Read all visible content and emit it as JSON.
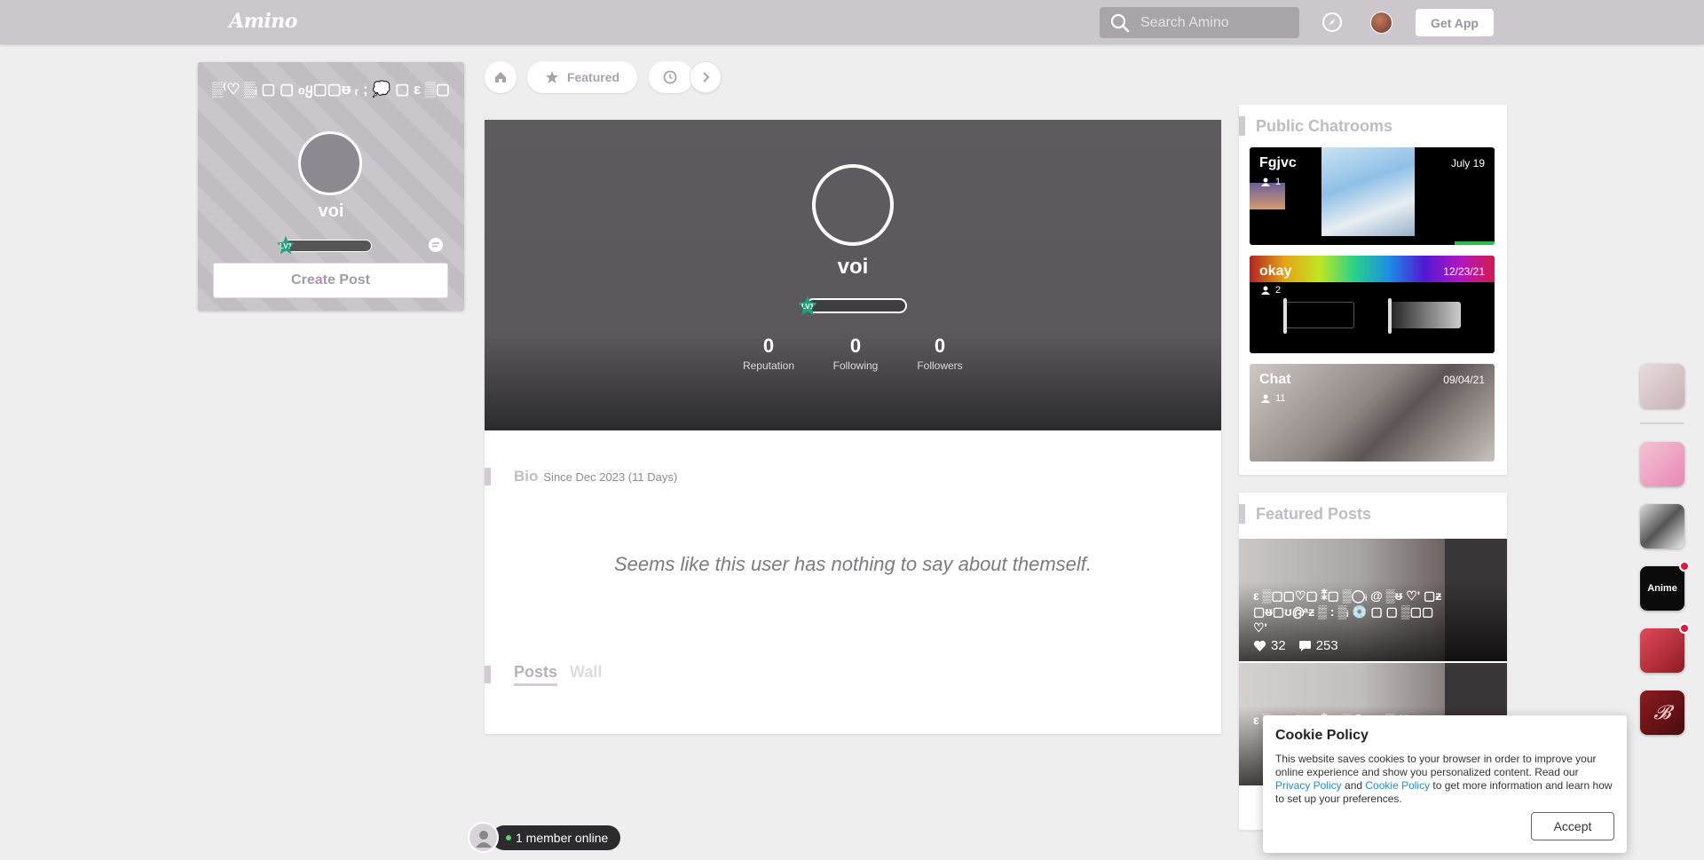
{
  "header": {
    "logo": "Amino",
    "search_placeholder": "Search Amino",
    "get_app": "Get App"
  },
  "left_card": {
    "community_name": "▒⁽♡ ▒ᵢ ▢ ▢ ℴყ▢▢ᵿ ᵣ ; 💭 ▢ ε ▒▢",
    "username": "voi",
    "level": "LV1",
    "create_post": "Create Post"
  },
  "tabs": {
    "featured": "Featured"
  },
  "profile": {
    "username": "voi",
    "level": "LV1",
    "stats": [
      {
        "value": "0",
        "label": "Reputation"
      },
      {
        "value": "0",
        "label": "Following"
      },
      {
        "value": "0",
        "label": "Followers"
      }
    ],
    "bio_title": "Bio",
    "bio_since": "Since Dec 2023 (11 Days)",
    "bio_text": "Seems like this user has nothing to say about themself.",
    "tab_posts": "Posts",
    "tab_wall": "Wall"
  },
  "public_chatrooms": {
    "title": "Public Chatrooms",
    "rooms": [
      {
        "name": "Fgjvc",
        "date": "July 19",
        "members": "1"
      },
      {
        "name": "okay",
        "date": "12/23/21",
        "members": "2"
      },
      {
        "name": "Chat",
        "date": "09/04/21",
        "members": "11"
      }
    ]
  },
  "featured_posts": {
    "title": "Featured Posts",
    "posts": [
      {
        "title": "ε ▒▢▢♡▢ ⁑▢ ▒◯ᵢ @ ▒ᵿ ♡' ▢ᵶ▢ᵿ▢ʊ൫ᵃᵶ ▒ : ▒ᵢ 💿 ▢ ▢ ▒▢▢ ♡'",
        "likes": "32",
        "comments": "253"
      },
      {
        "title": "ε ▒▢▢♡▢ ⁑▢ ▒◯ᵢ ▢ ▒ ♡' ▢ ▢",
        "likes": "",
        "comments": ""
      }
    ]
  },
  "side_communities": {
    "anime_label": "Anime"
  },
  "online": {
    "text": "1 member online"
  },
  "cookie": {
    "title": "Cookie Policy",
    "text1": "This website saves cookies to your browser in order to improve your online experience and show you personalized content. Read our ",
    "privacy_link": "Privacy Policy",
    "and": " and ",
    "cookie_link": "Cookie Policy",
    "text2": " to get more information and learn how to set up your preferences.",
    "accept": "Accept"
  }
}
